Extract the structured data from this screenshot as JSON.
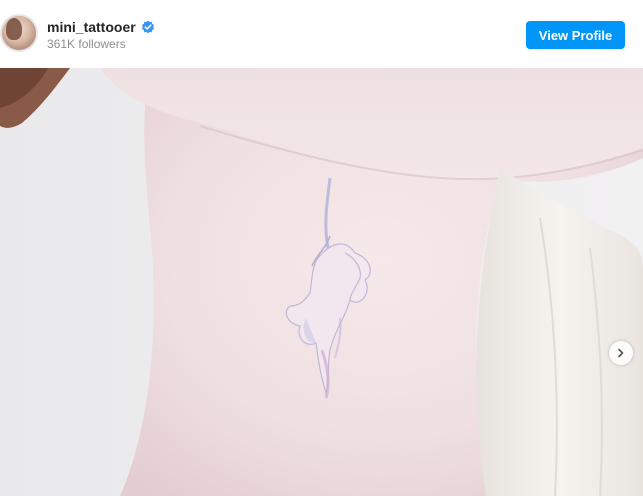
{
  "header": {
    "username": "mini_tattooer",
    "followers": "361K followers",
    "view_profile_label": "View Profile",
    "avatar_icon": "avatar",
    "verified_icon": "verified-badge-icon"
  },
  "post": {
    "image_description_icon": "unicorn-tattoo-photo",
    "next_icon": "chevron-right-icon"
  },
  "colors": {
    "accent": "#0095f6",
    "verified": "#3897f0",
    "username": "#262626",
    "muted": "#8e8e8e"
  }
}
